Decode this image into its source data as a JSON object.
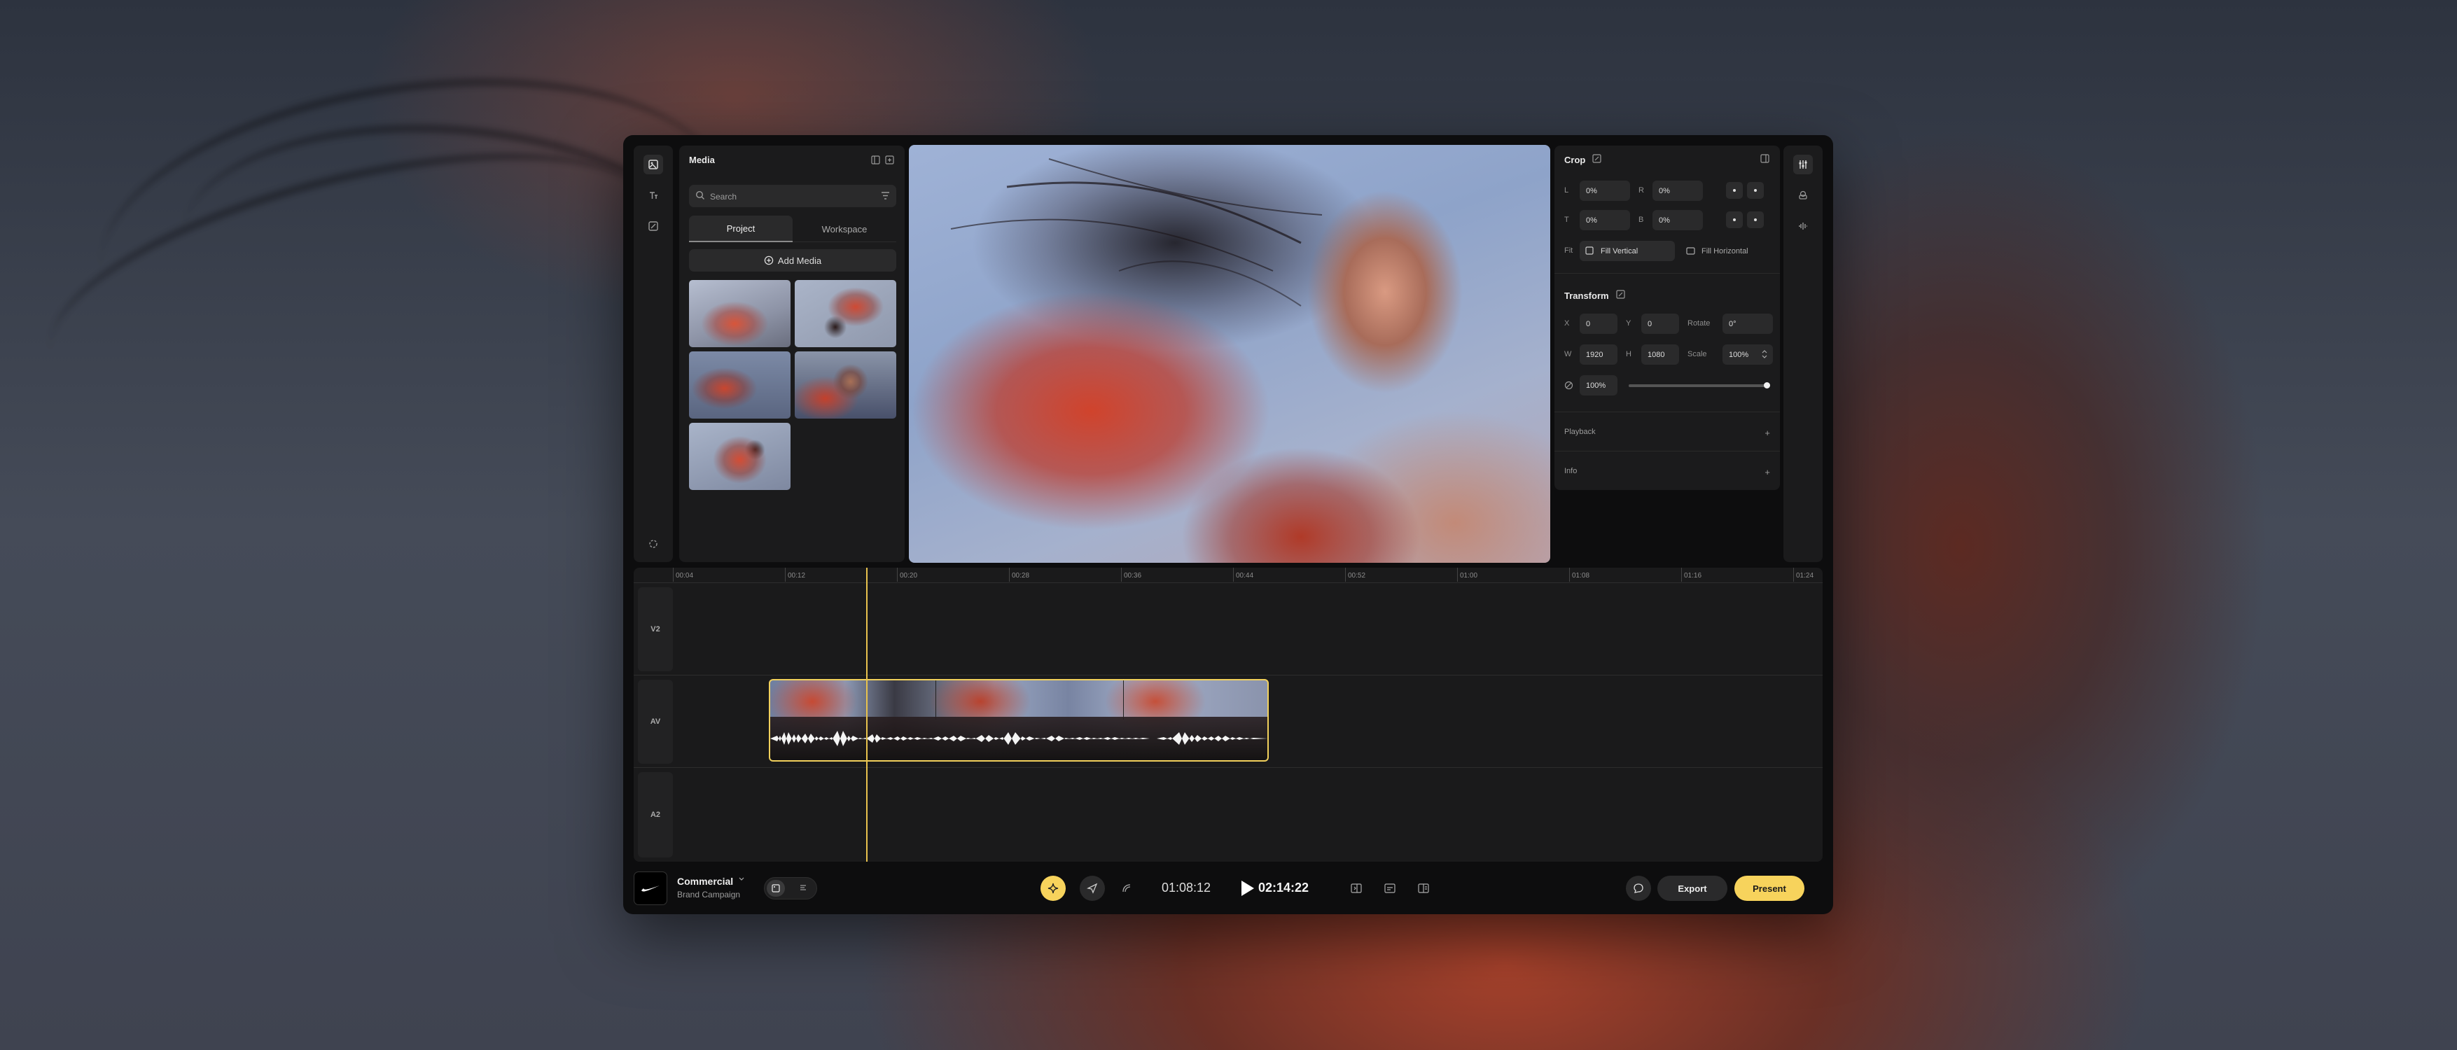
{
  "media": {
    "title": "Media",
    "search_placeholder": "Search",
    "tabs": [
      "Project",
      "Workspace"
    ],
    "add_media_label": "Add Media"
  },
  "crop": {
    "title": "Crop",
    "fields": [
      {
        "label": "L",
        "value": "0%"
      },
      {
        "label": "R",
        "value": "0%"
      },
      {
        "label": "T",
        "value": "0%"
      },
      {
        "label": "B",
        "value": "0%"
      }
    ],
    "fit_label": "Fit",
    "fit_options": [
      "Fill Vertical",
      "Fill Horizontal"
    ],
    "fit_selected": "Fill Vertical"
  },
  "transform": {
    "title": "Transform",
    "x": {
      "label": "X",
      "value": "0"
    },
    "y": {
      "label": "Y",
      "value": "0"
    },
    "rotate": {
      "label": "Rotate",
      "value": "0°"
    },
    "w": {
      "label": "W",
      "value": "1920"
    },
    "h": {
      "label": "H",
      "value": "1080"
    },
    "scale": {
      "label": "Scale",
      "value": "100%"
    },
    "opacity": {
      "value": "100%",
      "level": 1.0
    }
  },
  "sections": [
    "Playback",
    "Info"
  ],
  "timeline": {
    "ticks": [
      "00:04",
      "00:12",
      "00:20",
      "00:28",
      "00:36",
      "00:44",
      "00:52",
      "01:00",
      "01:08",
      "01:16",
      "01:24"
    ],
    "tracks": [
      "V2",
      "AV",
      "A2"
    ],
    "playhead": "00:17"
  },
  "bottom_bar": {
    "project_name": "Commercial",
    "project_subtitle": "Brand Campaign",
    "current_time": "01:08:12",
    "total_time": "02:14:22",
    "export_label": "Export",
    "present_label": "Present"
  },
  "colors": {
    "accent": "#f7d35c",
    "panel": "#1b1b1c",
    "background": "#0d0d0e"
  },
  "icons": [
    "media-icon",
    "text-icon",
    "edit-icon",
    "settings-icon",
    "search-icon",
    "filter-icon",
    "sliders-icon",
    "layers-icon",
    "audio-icon",
    "play-icon",
    "sparkle-icon",
    "send-icon",
    "chat-icon",
    "nike-logo"
  ]
}
